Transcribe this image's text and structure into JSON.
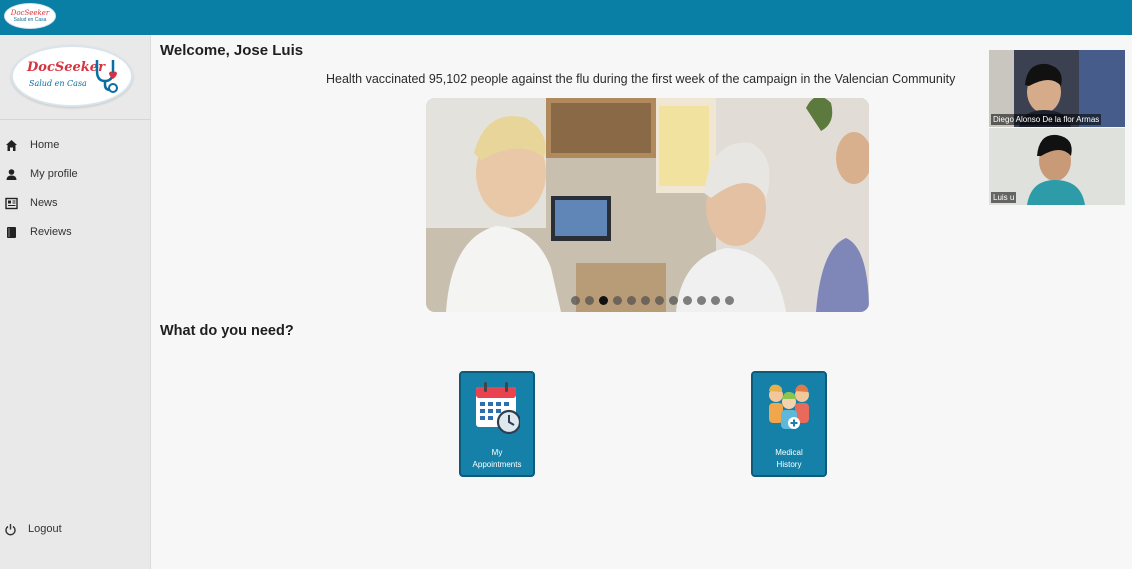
{
  "topbar": {
    "logo_line1": "DocSeeker",
    "logo_line2": "Salud en Casa"
  },
  "sidebar": {
    "logo_brand": "DocSeeker",
    "logo_sub": "Salud en Casa",
    "items": [
      {
        "label": "Home",
        "icon": "home-icon"
      },
      {
        "label": "My profile",
        "icon": "person-icon"
      },
      {
        "label": "News",
        "icon": "news-icon"
      },
      {
        "label": "Reviews",
        "icon": "book-icon"
      }
    ],
    "logout_label": "Logout"
  },
  "main": {
    "welcome": "Welcome, Jose Luis",
    "headline": "Health vaccinated 95,102 people against the flu during the first week of the campaign in the Valencian Community",
    "carousel": {
      "slide_count": 12,
      "active_index": 2
    },
    "need_title": "What do you need?",
    "cards": [
      {
        "label_line1": "My",
        "label_line2": "Appointments",
        "icon": "calendar-clock-icon"
      },
      {
        "label_line1": "Medical",
        "label_line2": "History",
        "icon": "family-medical-icon"
      }
    ]
  },
  "video_call": {
    "participants": [
      {
        "name": "Diego Alonso De la flor Armas"
      },
      {
        "name": "Luis u"
      }
    ]
  },
  "colors": {
    "topbar": "#0a7fa6",
    "card": "#1581a8",
    "sidebar": "#e9e9e9"
  }
}
